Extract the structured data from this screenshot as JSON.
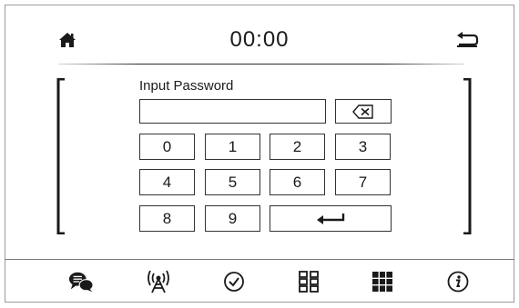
{
  "header": {
    "clock": "00:00",
    "home_icon": "home-icon",
    "back_icon": "back-arrow-icon"
  },
  "password": {
    "prompt": "Input Password",
    "value": "",
    "backspace_icon": "backspace-icon"
  },
  "keypad": {
    "keys": [
      "0",
      "1",
      "2",
      "3",
      "4",
      "5",
      "6",
      "7",
      "8",
      "9"
    ],
    "enter_icon": "enter-icon"
  },
  "footer": {
    "icons": [
      "chat-icon",
      "antenna-icon",
      "check-circle-icon",
      "apps-grid-icon",
      "tiles-grid-icon",
      "info-icon"
    ]
  },
  "colors": {
    "background": "#ffffff",
    "foreground": "#1a1a1a",
    "border": "#333333"
  }
}
